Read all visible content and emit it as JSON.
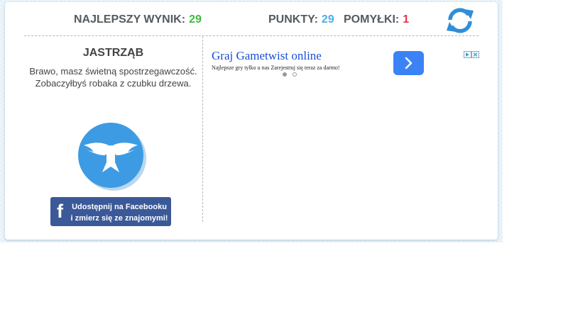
{
  "scoreboard": {
    "best_label": "NAJLEPSZY WYNIK:",
    "best_value": "29",
    "points_label": "PUNKTY:",
    "points_value": "29",
    "errors_label": "POMYŁKI:",
    "errors_value": "1",
    "refresh_icon": "refresh-icon"
  },
  "result": {
    "title": "JASTRZĄB",
    "description_line1": "Brawo, masz świetną spostrzegawczość.",
    "description_line2": "Zobaczyłbyś robaka z czubku drzewa.",
    "badge_icon": "hawk-icon",
    "share_line1": "Udostępnij na Facebooku",
    "share_line2": "i zmierz się ze znajomymi!",
    "share_icon_glyph": "f"
  },
  "ad": {
    "title": "Graj Gametwist online",
    "subtitle": "Najlepsze gry tylko u nas Zarejestruj się teraz za darmo!",
    "carousel_dots": 2,
    "active_dot": 1
  },
  "colors": {
    "best_value": "#3dbb3d",
    "points_value": "#4aaee6",
    "errors_value": "#e0364a",
    "refresh": "#2f8fd8",
    "badge": "#3d9be3",
    "facebook": "#3b5998",
    "ad_link": "#1a4fd8",
    "ad_button": "#3b82f6"
  }
}
